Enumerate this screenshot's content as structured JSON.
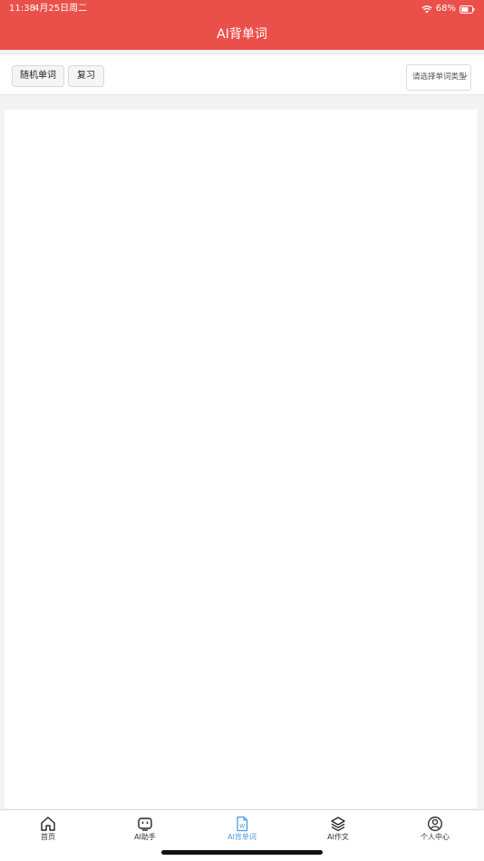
{
  "status_bar": {
    "time": "11:38",
    "date": "4月25日周二",
    "battery": "68%"
  },
  "header": {
    "title": "AI背单词",
    "bg_color": "#ea5049"
  },
  "toolbar": {
    "random_label": "随机单词",
    "review_label": "复习",
    "select_placeholder": "请选择单词类型"
  },
  "tabbar": {
    "active_color": "#4a9be3",
    "items": [
      {
        "label": "首页",
        "icon": "home-icon"
      },
      {
        "label": "AI助手",
        "icon": "robot-icon"
      },
      {
        "label": "AI背单词",
        "icon": "word-document-icon"
      },
      {
        "label": "AI作文",
        "icon": "layers-icon"
      },
      {
        "label": "个人中心",
        "icon": "user-circle-icon"
      }
    ],
    "active_index": 2
  }
}
